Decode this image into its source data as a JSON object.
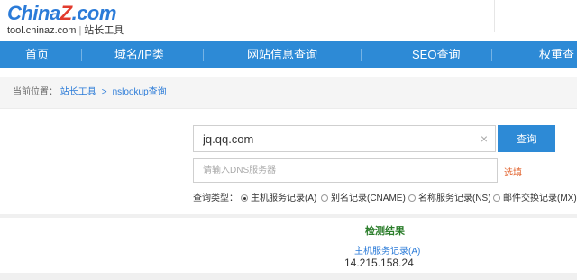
{
  "header": {
    "logo_text_a": "China",
    "logo_text_z": "Z",
    "logo_text_b": ".com",
    "site_url": "tool.chinaz.com",
    "separator": "|",
    "site_name": "站长工具"
  },
  "nav": {
    "items": [
      "首页",
      "域名/IP类",
      "网站信息查询",
      "SEO查询",
      "权重查"
    ]
  },
  "breadcrumb": {
    "prefix": "当前位置：",
    "home": "站长工具",
    "arrow": ">",
    "current": "nslookup查询"
  },
  "form": {
    "domain_value": "jq.qq.com",
    "clear_icon": "×",
    "query_button": "查询",
    "dns_placeholder": "请输入DNS服务器",
    "select_link": "选填",
    "type_label": "查询类型：",
    "types": [
      {
        "label": "主机服务记录(A)",
        "checked": true
      },
      {
        "label": "别名记录(CNAME)",
        "checked": false
      },
      {
        "label": "名称服务记录(NS)",
        "checked": false
      },
      {
        "label": "邮件交换记录(MX)",
        "checked": false
      }
    ]
  },
  "result": {
    "title": "检测结果",
    "record_type": "主机服务记录(A)",
    "ip": "14.215.158.24"
  },
  "colors": {
    "brand_blue": "#2d8ad6",
    "brand_red": "#e23b2e",
    "result_green": "#2a7d2a",
    "link_orange": "#e2632e"
  }
}
